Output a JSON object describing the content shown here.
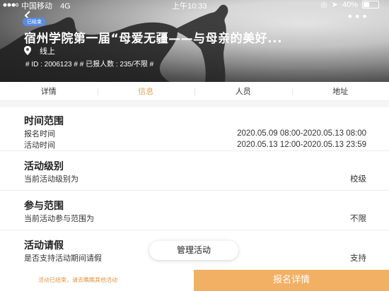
{
  "status_bar": {
    "carrier": "中国移动",
    "network": "4G",
    "time": "上午10:33",
    "battery": "40%"
  },
  "header": {
    "ended_badge": "已结束",
    "title": "宿州学院第一届“母爱无疆——与母亲的美好...",
    "location": "线上",
    "meta": "# ID : 2006123 #   # 已报人数 : 235/不限 #",
    "back_icon": "chevron-left-icon",
    "more_icon": "more-icon",
    "location_icon": "location-pin-icon"
  },
  "tabs": [
    {
      "label": "详情",
      "active": false
    },
    {
      "label": "信息",
      "active": true
    },
    {
      "label": "人员",
      "active": false
    },
    {
      "label": "地址",
      "active": false
    }
  ],
  "sections": {
    "time_range": {
      "title": "时间范围",
      "signup_label": "报名时间",
      "signup_value": "2020.05.09 08:00-2020.05.13 08:00",
      "activity_label": "活动时间",
      "activity_value": "2020.05.13 12:00-2020.05.13 23:59"
    },
    "level": {
      "title": "活动级别",
      "label": "当前活动级别为",
      "value": "校级"
    },
    "scope": {
      "title": "参与范围",
      "label": "当前活动参与范围为",
      "value": "不限"
    },
    "leave": {
      "title": "活动请假",
      "label": "是否支持活动期间请假",
      "value": "支持"
    }
  },
  "manage_button": "管理活动",
  "bottom": {
    "note": "活动已结束，请去瞧瞧其他活动",
    "cta": "报名详情"
  },
  "colors": {
    "accent": "#e3a35a",
    "cta_bg": "#f2b064",
    "badge_bg": "#5a8be0"
  }
}
